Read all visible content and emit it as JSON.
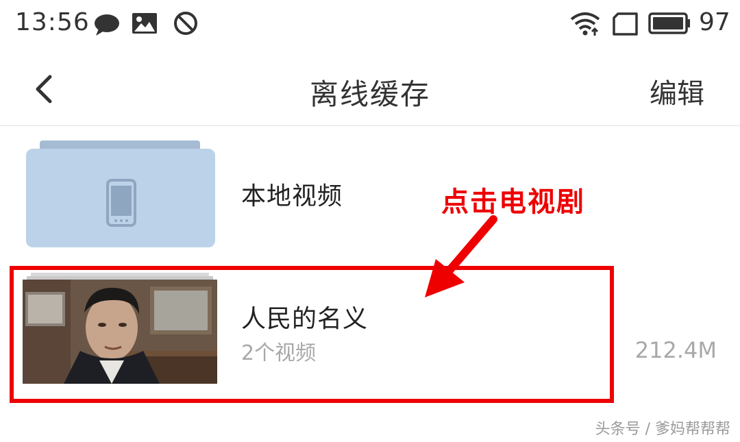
{
  "status_bar": {
    "time": "13:56",
    "battery_level": "97",
    "icons": [
      "chat-bubble-icon",
      "image-icon",
      "do-not-disturb-icon",
      "wifi-icon",
      "sim-icon",
      "battery-icon"
    ]
  },
  "header": {
    "title": "离线缓存",
    "edit_label": "编辑",
    "back_icon": "chevron-left-icon"
  },
  "rows": {
    "local": {
      "title": "本地视频",
      "icon": "phone-icon"
    },
    "series": {
      "title": "人民的名义",
      "subtitle": "2个视频",
      "size": "212.4M"
    }
  },
  "annotation": {
    "label": "点击电视剧",
    "color": "#ee0000"
  },
  "watermark": "头条号 / 爹妈帮帮帮",
  "colors": {
    "folder": "#bcd2e8",
    "folder_tab": "#a5bbd4",
    "secondary_text": "#a8a8a8"
  }
}
